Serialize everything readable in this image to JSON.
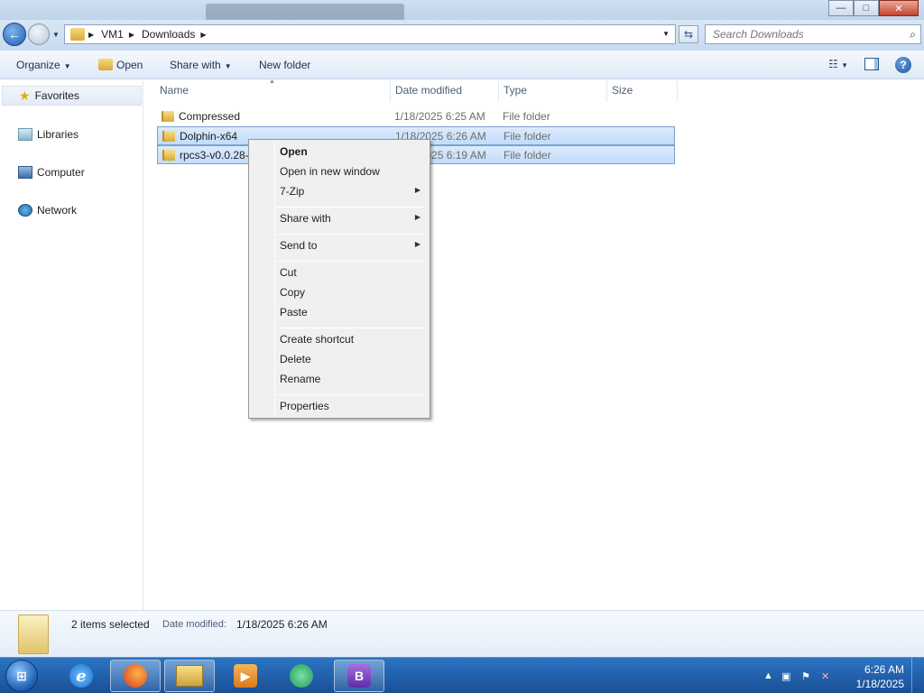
{
  "window": {
    "minimize_glyph": "—",
    "maximize_glyph": "□",
    "close_glyph": "✕"
  },
  "address": {
    "back_glyph": "←",
    "breadcrumb": [
      "VM1",
      "Downloads"
    ],
    "search_placeholder": "Search Downloads",
    "search_icon": "magnifier-icon"
  },
  "toolbar": {
    "organize": "Organize",
    "open": "Open",
    "share_with": "Share with",
    "new_folder": "New folder",
    "help_glyph": "?"
  },
  "navpane": {
    "favorites": "Favorites",
    "libraries": "Libraries",
    "computer": "Computer",
    "network": "Network"
  },
  "columns": {
    "name": "Name",
    "date_modified": "Date modified",
    "type": "Type",
    "size": "Size"
  },
  "files": [
    {
      "name": "Compressed",
      "date": "1/18/2025 6:25 AM",
      "type": "File folder",
      "selected": false
    },
    {
      "name": "Dolphin-x64",
      "date": "1/18/2025 6:26 AM",
      "type": "File folder",
      "selected": true
    },
    {
      "name": "rpcs3-v0.0.28-1",
      "date": "1/18/2025 6:19 AM",
      "type": "File folder",
      "selected": true
    }
  ],
  "context_menu": {
    "open": "Open",
    "open_new_window": "Open in new window",
    "seven_zip": "7-Zip",
    "share_with": "Share with",
    "send_to": "Send to",
    "cut": "Cut",
    "copy": "Copy",
    "paste": "Paste",
    "create_shortcut": "Create shortcut",
    "delete": "Delete",
    "rename": "Rename",
    "properties": "Properties"
  },
  "details": {
    "count": "2 items selected",
    "date_label": "Date modified:",
    "date_value": "1/18/2025 6:26 AM"
  },
  "taskbar": {
    "apps": [
      "internet-explorer",
      "firefox",
      "windows-explorer",
      "media-player",
      "chat-app",
      "b-app"
    ],
    "clock_time": "6:26 AM",
    "clock_date": "1/18/2025"
  }
}
